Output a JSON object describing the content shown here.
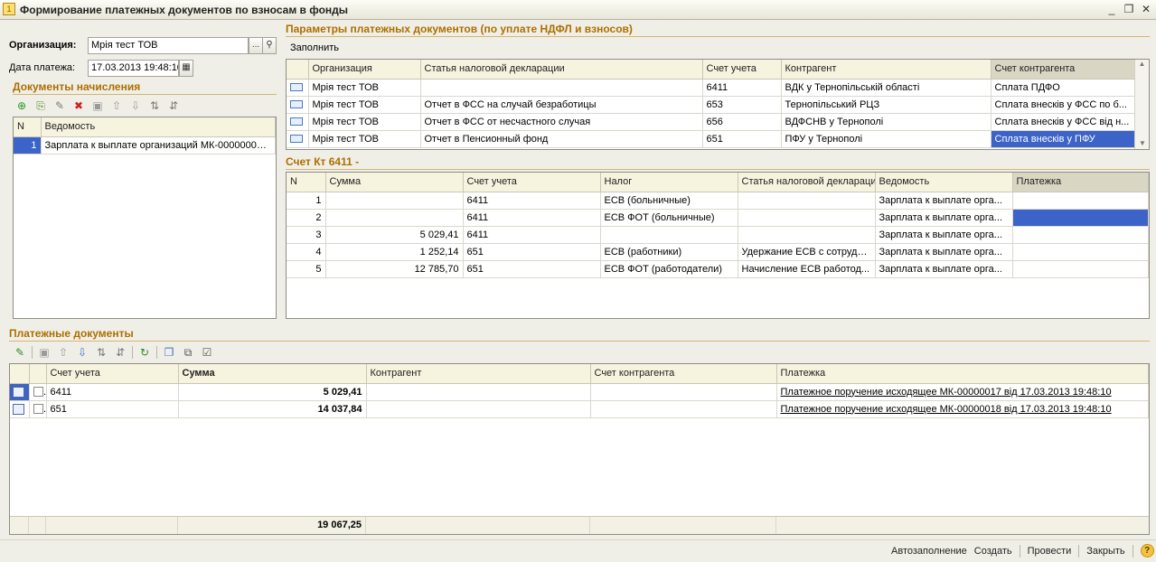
{
  "window": {
    "title": "Формирование платежных документов по взносам в фонды",
    "controls": [
      "_",
      "❐",
      "✕"
    ]
  },
  "header": {
    "org_label": "Организация:",
    "org_value": "Мрія тест ТОВ",
    "org_pick": "...",
    "date_label": "Дата платежа:",
    "date_value": "17.03.2013 19:48:10"
  },
  "accruals": {
    "caption": "Документы начисления",
    "columns": [
      "N",
      "Ведомость"
    ],
    "rows": [
      {
        "n": "1",
        "statement": "Зарплата к выплате организаций МК-00000003 ..."
      }
    ]
  },
  "params": {
    "caption": "Параметры платежных документов (по уплате НДФЛ и взносов)",
    "fill_label": "Заполнить",
    "columns": [
      "Организация",
      "Статья налоговой декларации",
      "Счет учета",
      "Контрагент",
      "Счет контрагента"
    ],
    "rows": [
      {
        "org": "Мрія тест ТОВ",
        "article": "",
        "account": "6411",
        "counterparty": "ВДК у Тернопільській області",
        "cp_account": "Сплата ПДФО"
      },
      {
        "org": "Мрія тест ТОВ",
        "article": "Отчет в ФСС на случай безработицы",
        "account": "653",
        "counterparty": "Тернопільський РЦЗ",
        "cp_account": "Сплата внесків у ФСС по б..."
      },
      {
        "org": "Мрія тест ТОВ",
        "article": "Отчет в ФСС от несчастного случая",
        "account": "656",
        "counterparty": "ВДФСНВ у Тернополі",
        "cp_account": "Сплата внесків у ФСС від н..."
      },
      {
        "org": "Мрія тест ТОВ",
        "article": "Отчет в Пенсионный фонд",
        "account": "651",
        "counterparty": "ПФУ у Тернополі",
        "cp_account": "Сплата внесків у ПФУ"
      }
    ]
  },
  "credit": {
    "caption": "Счет Кт 6411 -",
    "columns": [
      "N",
      "Сумма",
      "Счет учета",
      "Налог",
      "Статья налоговой декларации",
      "Ведомость",
      "Платежка"
    ],
    "rows": [
      {
        "n": "1",
        "sum": "",
        "account": "6411",
        "tax": "ЕСВ (больничные)",
        "article": "",
        "statement": "Зарплата к выплате орга...",
        "payment": ""
      },
      {
        "n": "2",
        "sum": "",
        "account": "6411",
        "tax": "ЕСВ ФОТ (больничные)",
        "article": "",
        "statement": "Зарплата к выплате орга...",
        "payment": ""
      },
      {
        "n": "3",
        "sum": "5 029,41",
        "account": "6411",
        "tax": "",
        "article": "",
        "statement": "Зарплата к выплате орга...",
        "payment": ""
      },
      {
        "n": "4",
        "sum": "1 252,14",
        "account": "651",
        "tax": "ЕСВ (работники)",
        "article": "Удержание ЕСВ с сотрудн...",
        "statement": "Зарплата к выплате орга...",
        "payment": ""
      },
      {
        "n": "5",
        "sum": "12 785,70",
        "account": "651",
        "tax": "ЕСВ ФОТ (работодатели)",
        "article": "Начисление ЕСВ работод...",
        "statement": "Зарплата к выплате орга...",
        "payment": ""
      }
    ]
  },
  "payments": {
    "caption": "Платежные документы",
    "columns": [
      "Счет учета",
      "Сумма",
      "Контрагент",
      "Счет контрагента",
      "Платежка"
    ],
    "rows": [
      {
        "account": "6411",
        "sum": "5 029,41",
        "counterparty": "",
        "cp_account": "",
        "payment": "Платежное поручение исходящее МК-00000017 від 17.03.2013 19:48:10"
      },
      {
        "account": "651",
        "sum": "14 037,84",
        "counterparty": "",
        "cp_account": "",
        "payment": "Платежное поручение исходящее МК-00000018 від 17.03.2013 19:48:10"
      }
    ],
    "total": "19 067,25"
  },
  "footer": {
    "autofill": "Автозаполнение",
    "create": "Создать",
    "post": "Провести",
    "close": "Закрыть",
    "help": "?"
  },
  "colors": {
    "caption": "#ad6f00",
    "selection": "#3c63c7",
    "header_bg": "#f6f3df",
    "window_bg": "#f0efe7"
  }
}
